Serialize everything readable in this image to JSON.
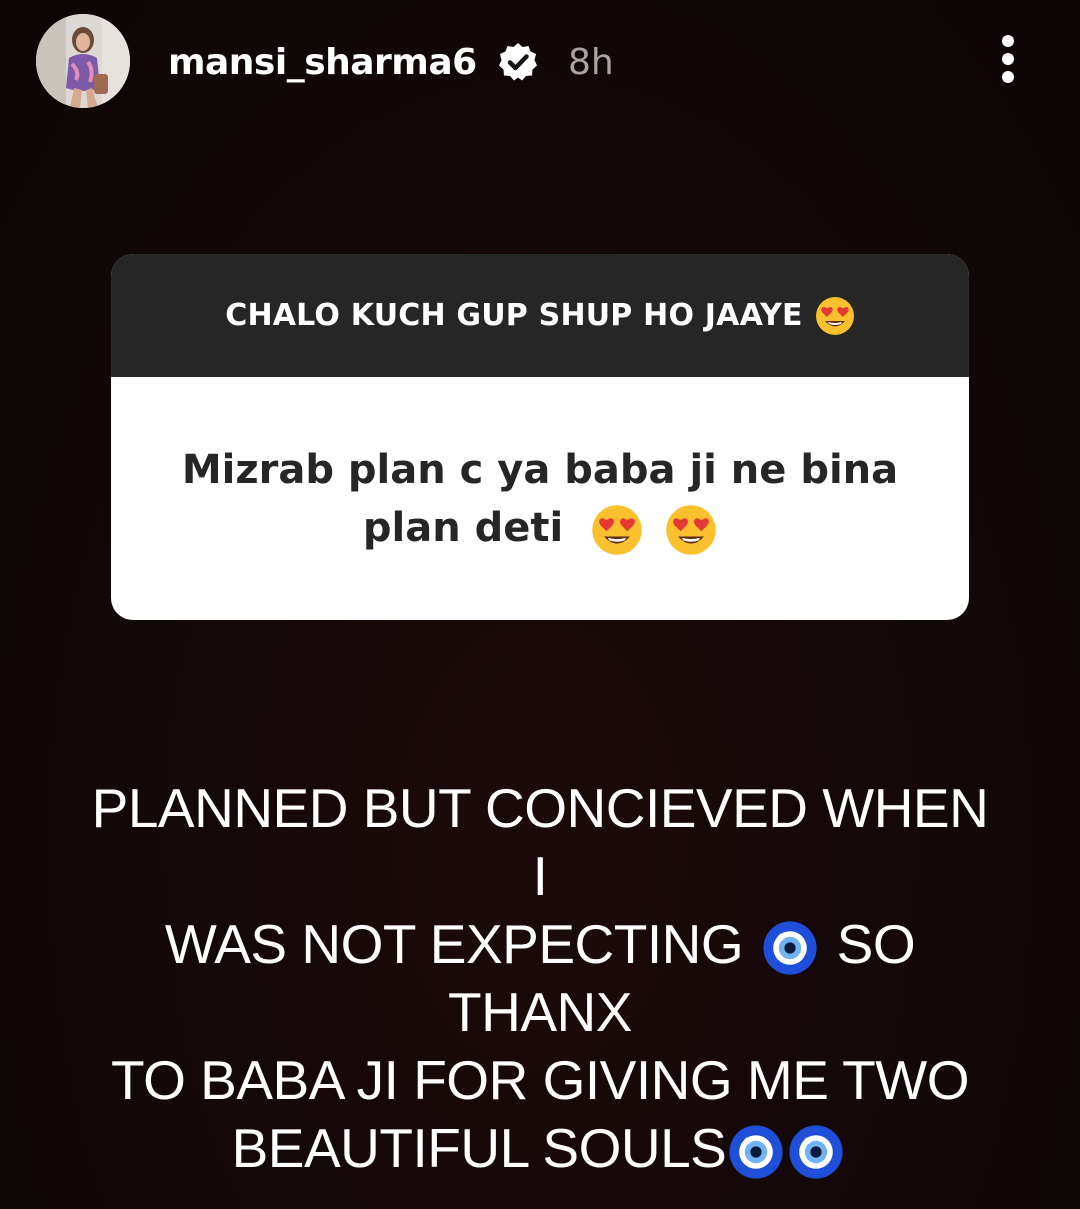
{
  "header": {
    "username": "mansi_sharma6",
    "time": "8h",
    "avatar_icon": "profile-photo",
    "verified_icon": "verified-badge-icon",
    "more_icon": "more-vertical-icon"
  },
  "question_card": {
    "prompt": "CHALO KUCH GUP SHUP HO JAAYE",
    "question_line1": "Mizrab plan c ya baba ji ne bina",
    "question_line2": "plan deti",
    "emoji": "heart-eyes-emoji"
  },
  "answer": {
    "line1": "PLANNED BUT CONCIEVED WHEN I",
    "line2a": "WAS NOT EXPECTING",
    "line2b": "SO THANX",
    "line3": "TO BABA JI FOR GIVING ME TWO",
    "line4": "BEAUTIFUL SOULS",
    "emoji": "nazar-amulet-emoji"
  },
  "colors": {
    "background": "#140808",
    "card_header": "#262626",
    "card_body": "#ffffff",
    "time_text": "#a8a4a4"
  }
}
